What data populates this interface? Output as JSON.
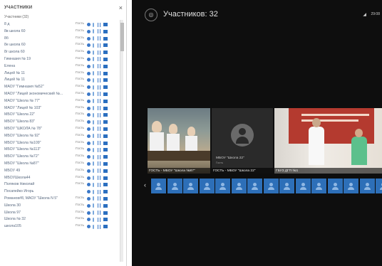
{
  "left_panel": {
    "title": "УЧАСТНИКИ",
    "close": "×",
    "subtitle": "Участники (32)",
    "participants": [
      {
        "name": "8 д",
        "role": "Гость"
      },
      {
        "name": "8в школа 60",
        "role": "Гость"
      },
      {
        "name": "8б",
        "role": "Гость"
      },
      {
        "name": "8е школа 60",
        "role": "Гость"
      },
      {
        "name": "8г школа 60",
        "role": "Гость"
      },
      {
        "name": "Гимназия № 19",
        "role": "Гость"
      },
      {
        "name": "Елена",
        "role": "Гость"
      },
      {
        "name": "Лицей № 11",
        "role": "Гость"
      },
      {
        "name": "Лицей № 11",
        "role": "Гость"
      },
      {
        "name": "МАОУ \"Гимназия №52\"",
        "role": "Гость"
      },
      {
        "name": "МАОУ \"Лицей экономический №...",
        "role": "Гость"
      },
      {
        "name": "МАОУ \"Школа № 77\"",
        "role": "Гость"
      },
      {
        "name": "МАОУ \"Лицей № 103\"",
        "role": "Гость"
      },
      {
        "name": "МБОУ \"Школа 22\"",
        "role": "Гость"
      },
      {
        "name": "МБОУ \"Школа 83\"",
        "role": "Гость"
      },
      {
        "name": "МБОУ \"ШКОЛА № 78\"",
        "role": "Гость"
      },
      {
        "name": "МБОУ \"Школа № 92\"",
        "role": "Гость"
      },
      {
        "name": "МБОУ \"Школа №109\"",
        "role": "Гость"
      },
      {
        "name": "МБОУ \"Школа №113\"",
        "role": "Гость"
      },
      {
        "name": "МБОУ \"Школа №72\"",
        "role": "Гость"
      },
      {
        "name": "МБОУ \"Школа №87\"",
        "role": "Гость"
      },
      {
        "name": "МБОУ 49",
        "role": "Гость"
      },
      {
        "name": "МБОУШкола44",
        "role": "Гость"
      },
      {
        "name": "Поляков Николай",
        "role": "Гость"
      },
      {
        "name": "Посапейко Игорь",
        "role": ""
      },
      {
        "name": "Романов#8, МАОУ \"Школа N 5\"",
        "role": "Гость"
      },
      {
        "name": "Школа 30",
        "role": "Гость"
      },
      {
        "name": "Школа 97",
        "role": "Гость"
      },
      {
        "name": "Школа № 32",
        "role": "Гость"
      },
      {
        "name": "школа105",
        "role": "Гость"
      }
    ]
  },
  "right_panel": {
    "title": "Участников: 32",
    "time": "29:08",
    "tiles": [
      {
        "label": "ГОСТЬ - МБОУ \"Школа №87\""
      },
      {
        "label": "ГОСТЬ - МБОУ \"Школа 22\"",
        "caption": "МБОУ \"Школа 22\"",
        "caption2": "Гость"
      },
      {
        "label": "ГБУЗ ДГП №1"
      }
    ],
    "thumbnail_count": 15
  },
  "colors": {
    "accent": "#2d6fb8",
    "dark_bg": "#0e0e0e"
  }
}
